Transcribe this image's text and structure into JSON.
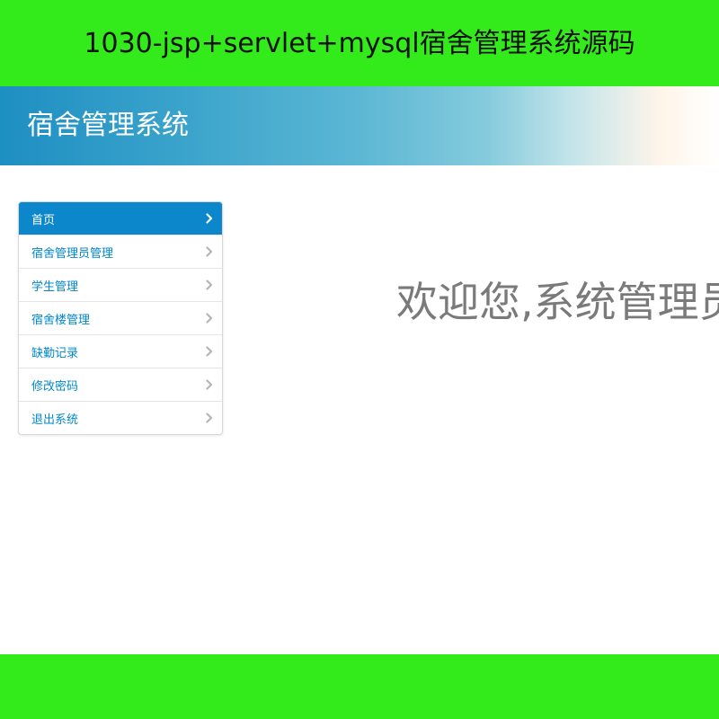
{
  "banner": {
    "text": "1030-jsp+servlet+mysql宿舍管理系统源码",
    "color": "#33ea1a"
  },
  "header": {
    "title": "宿舍管理系统"
  },
  "sidebar": {
    "items": [
      {
        "label": "首页",
        "active": true,
        "icon": "chevron-right-icon"
      },
      {
        "label": "宿舍管理员管理",
        "active": false,
        "icon": "chevron-right-icon"
      },
      {
        "label": "学生管理",
        "active": false,
        "icon": "chevron-right-icon"
      },
      {
        "label": "宿舍楼管理",
        "active": false,
        "icon": "chevron-right-icon"
      },
      {
        "label": "缺勤记录",
        "active": false,
        "icon": "chevron-right-icon"
      },
      {
        "label": "修改密码",
        "active": false,
        "icon": "chevron-right-icon"
      },
      {
        "label": "退出系统",
        "active": false,
        "icon": "chevron-right-icon"
      }
    ],
    "active_color": "#0c87cc",
    "link_color": "#0088cc"
  },
  "main": {
    "welcome": "欢迎您,系统管理员"
  }
}
